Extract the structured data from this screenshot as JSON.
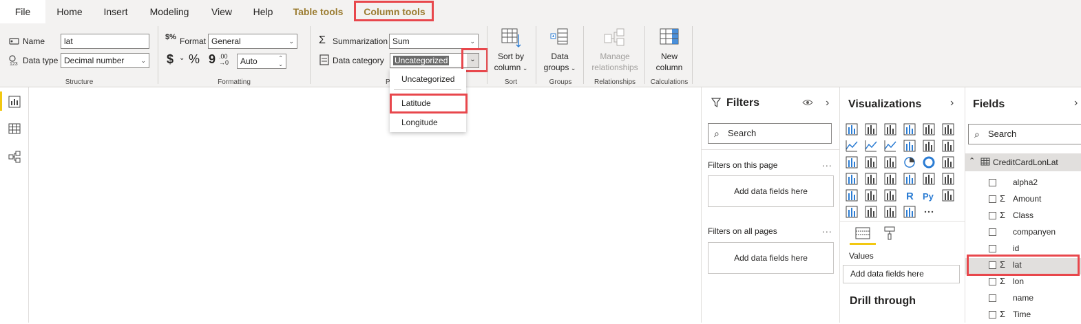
{
  "tabs": {
    "file": "File",
    "home": "Home",
    "insert": "Insert",
    "modeling": "Modeling",
    "view": "View",
    "help": "Help",
    "table_tools": "Table tools",
    "column_tools": "Column tools"
  },
  "structure": {
    "name_label": "Name",
    "name_value": "lat",
    "datatype_label": "Data type",
    "datatype_value": "Decimal number",
    "group_label": "Structure"
  },
  "formatting": {
    "format_label": "Format",
    "format_value": "General",
    "currency_symbol": "$",
    "percent_symbol": "%",
    "comma_symbol": "9",
    "decimals_value": "Auto",
    "group_label": "Formatting"
  },
  "properties": {
    "summarization_label": "Summarization",
    "summarization_value": "Sum",
    "datacategory_label": "Data category",
    "datacategory_value": "Uncategorized",
    "group_label_partial": "Pr"
  },
  "sort": {
    "button_line1": "Sort by",
    "button_line2": "column",
    "group_label": "Sort"
  },
  "groups": {
    "button_line1": "Data",
    "button_line2": "groups",
    "group_label": "Groups"
  },
  "relationships": {
    "button_line1": "Manage",
    "button_line2": "relationships",
    "group_label": "Relationships"
  },
  "calculations": {
    "button_line1": "New",
    "button_line2": "column",
    "group_label": "Calculations"
  },
  "dropdown": {
    "options": [
      "Uncategorized",
      "Latitude",
      "Longitude"
    ]
  },
  "filters": {
    "title": "Filters",
    "search_placeholder": "Search",
    "on_this_page": "Filters on this page",
    "on_all_pages": "Filters on all pages",
    "add_fields_1": "Add data fields here",
    "add_fields_2": "Add data fields here",
    "more": "..."
  },
  "visualizations": {
    "title": "Visualizations",
    "values_label": "Values",
    "add_fields": "Add data fields here",
    "drill_through": "Drill through",
    "more": "..."
  },
  "fields": {
    "title": "Fields",
    "search_placeholder": "Search",
    "table_name": "CreditCardLonLat",
    "items": [
      {
        "name": "alpha2",
        "sigma": ""
      },
      {
        "name": "Amount",
        "sigma": "Σ"
      },
      {
        "name": "Class",
        "sigma": "Σ"
      },
      {
        "name": "companyen",
        "sigma": ""
      },
      {
        "name": "id",
        "sigma": ""
      },
      {
        "name": "lat",
        "sigma": "Σ"
      },
      {
        "name": "lon",
        "sigma": "Σ"
      },
      {
        "name": "name",
        "sigma": ""
      },
      {
        "name": "Time",
        "sigma": "Σ"
      }
    ]
  },
  "colors": {
    "highlight_red": "#e8474c",
    "context_tab_gold": "#9a7b2f",
    "accent_yellow": "#f2c811",
    "ribbon_bg": "#f3f2f1"
  }
}
